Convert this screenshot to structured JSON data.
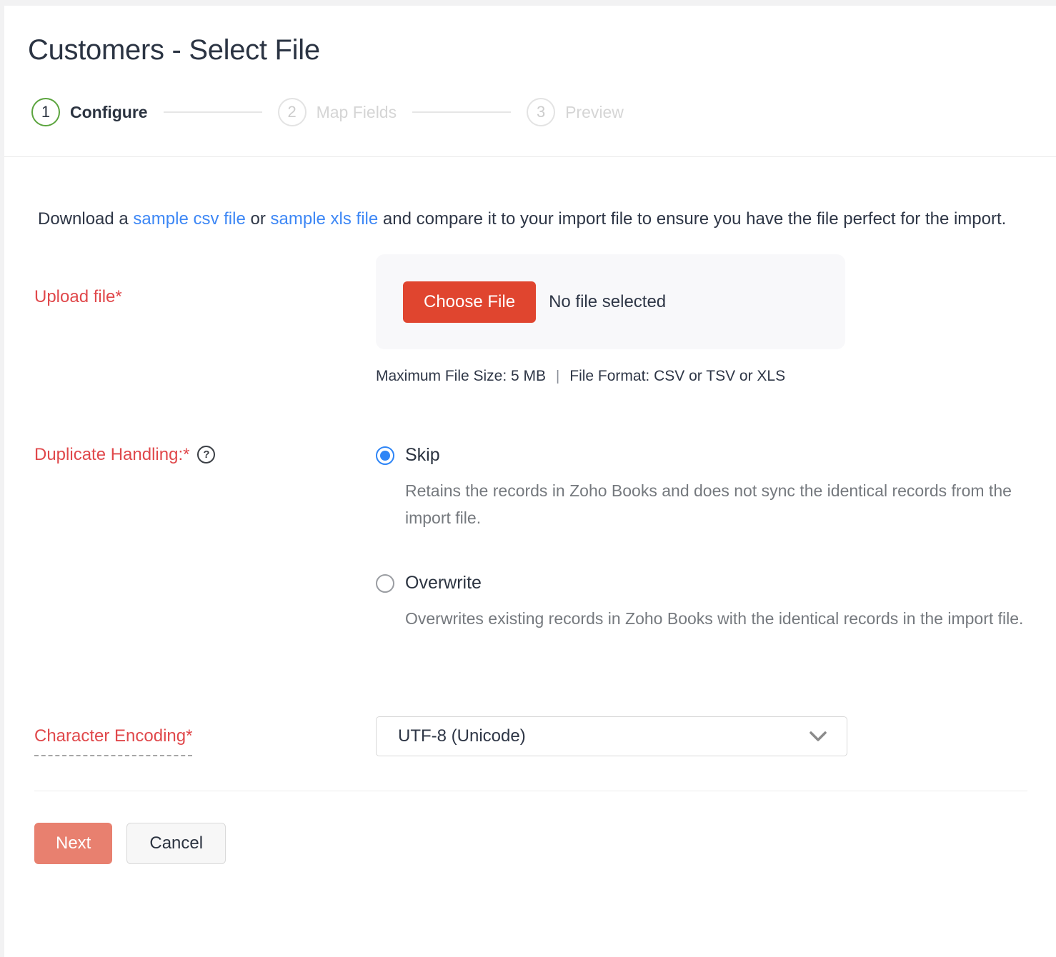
{
  "page": {
    "title": "Customers - Select File"
  },
  "stepper": {
    "steps": [
      {
        "number": "1",
        "label": "Configure",
        "state": "active"
      },
      {
        "number": "2",
        "label": "Map Fields",
        "state": "inactive"
      },
      {
        "number": "3",
        "label": "Preview",
        "state": "inactive"
      }
    ]
  },
  "intro": {
    "text_before": "Download a ",
    "link_csv": "sample csv file",
    "text_middle": " or ",
    "link_xls": "sample xls file",
    "text_after": " and compare it to your import file to ensure you have the file perfect for the import."
  },
  "upload": {
    "label": "Upload file*",
    "choose_button": "Choose File",
    "no_file_text": "No file selected",
    "max_size": "Maximum File Size: 5 MB",
    "separator": "|",
    "format": "File Format: CSV or TSV or XLS"
  },
  "duplicate": {
    "label": "Duplicate Handling:*",
    "help_icon": "?",
    "options": [
      {
        "label": "Skip",
        "selected": true,
        "description": "Retains the records in Zoho Books and does not sync the identical records from the import file."
      },
      {
        "label": "Overwrite",
        "selected": false,
        "description": "Overwrites existing records in Zoho Books with the identical records in the import file."
      }
    ]
  },
  "encoding": {
    "label": "Character Encoding*",
    "value": "UTF-8 (Unicode)"
  },
  "actions": {
    "next": "Next",
    "cancel": "Cancel"
  },
  "colors": {
    "accent_red": "#e0452f",
    "label_red": "#e0484b",
    "link_blue": "#3d87f5",
    "radio_blue": "#2e85f6",
    "step_green": "#5ba43e",
    "next_salmon": "#e8806f",
    "text_dark": "#2b3340",
    "text_gray": "#75797e"
  }
}
